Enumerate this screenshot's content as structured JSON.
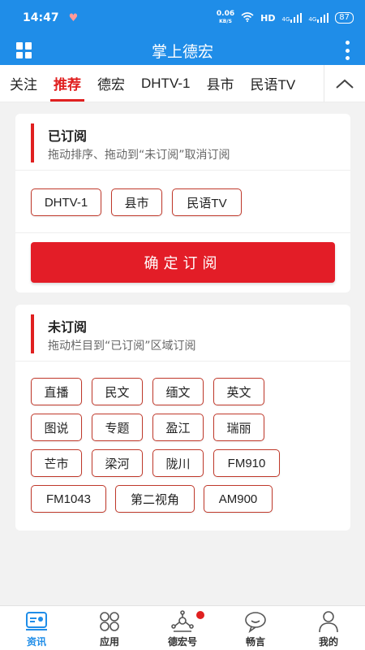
{
  "status_bar": {
    "time": "14:47",
    "net_speed_value": "0.06",
    "net_speed_unit": "KB/S",
    "network": "HD",
    "signal1": "4G",
    "signal2": "4G",
    "battery": "87"
  },
  "header": {
    "title": "掌上德宏"
  },
  "tabs": {
    "items": [
      "关注",
      "推荐",
      "德宏",
      "DHTV-1",
      "县市",
      "民语TV"
    ],
    "active_index": 1
  },
  "subscribed": {
    "title": "已订阅",
    "hint": "拖动排序、拖动到“未订阅”取消订阅",
    "channels": [
      "DHTV-1",
      "县市",
      "民语TV"
    ],
    "confirm_label": "确定订阅"
  },
  "unsubscribed": {
    "title": "未订阅",
    "hint": "拖动栏目到“已订阅”区域订阅",
    "channels": [
      "直播",
      "民文",
      "缅文",
      "英文",
      "图说",
      "专题",
      "盈江",
      "瑞丽",
      "芒市",
      "梁河",
      "陇川",
      "FM910",
      "FM1043",
      "第二视角",
      "AM900"
    ]
  },
  "bottom_nav": {
    "items": [
      {
        "label": "资讯",
        "icon": "news-icon",
        "active": true
      },
      {
        "label": "应用",
        "icon": "apps-icon",
        "active": false
      },
      {
        "label": "德宏号",
        "icon": "network-icon",
        "active": false,
        "badge": true
      },
      {
        "label": "畅言",
        "icon": "chat-icon",
        "active": false
      },
      {
        "label": "我的",
        "icon": "profile-icon",
        "active": false
      }
    ]
  },
  "colors": {
    "primary": "#1f8de8",
    "accent": "#e02020",
    "button": "#e31d27"
  }
}
